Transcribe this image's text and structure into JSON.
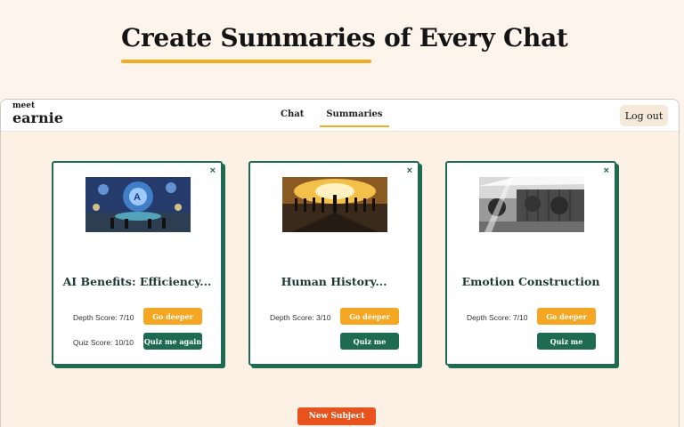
{
  "hero": {
    "title": "Create Summaries of Every Chat"
  },
  "app": {
    "logo_top": "meet",
    "logo_bottom": "earnie",
    "nav": [
      {
        "label": "Chat",
        "active": false
      },
      {
        "label": "Summaries",
        "active": true
      }
    ],
    "logout_label": "Log out"
  },
  "cards": [
    {
      "title": "AI Benefits: Efficiency...",
      "depth_label": "Depth Score: 7/10",
      "quiz_label": "Quiz Score: 10/10",
      "deeper_button": "Go deeper",
      "quiz_button": "Quiz me again",
      "close": "×",
      "image": "ai-network-illustration"
    },
    {
      "title": "Human History...",
      "depth_label": "Depth Score: 3/10",
      "quiz_label": "",
      "deeper_button": "Go deeper",
      "quiz_button": "Quiz me",
      "close": "×",
      "image": "silhouettes-sunrise-illustration"
    },
    {
      "title": "Emotion Construction",
      "depth_label": "Depth Score: 7/10",
      "quiz_label": "",
      "deeper_button": "Go deeper",
      "quiz_button": "Quiz me",
      "close": "×",
      "image": "building-trees-bw-illustration"
    }
  ],
  "new_subject_label": "New Subject",
  "colors": {
    "accent_yellow": "#f1ad22",
    "deep_green": "#1f6b52",
    "orange_button": "#e8521d",
    "background": "#fdf5ec"
  }
}
